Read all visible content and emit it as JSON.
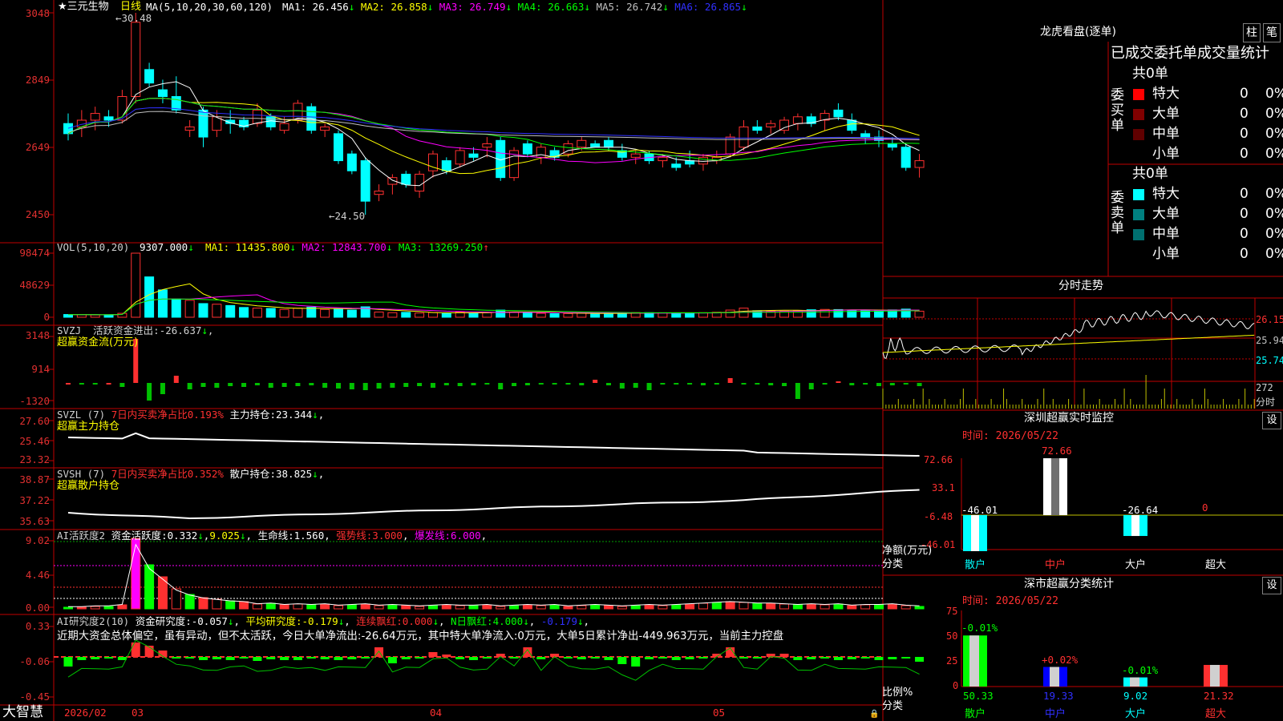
{
  "window": {
    "stock_label": "★三元生物",
    "period_label": "日线",
    "software": "大智慧"
  },
  "colors": {
    "up": "#ff3030",
    "down": "#00ffff",
    "ma1": "#ffffff",
    "ma2": "#ffff00",
    "ma3": "#ff00ff",
    "ma4": "#00ff00",
    "ma5": "#c0c0c0",
    "ma6": "#3030ff"
  },
  "price_panel": {
    "ma_title": "MA(5,10,20,30,60,120)",
    "ma_items": [
      {
        "label": "MA1:",
        "value": "26.456",
        "arrow": "↓",
        "color": "#ffffff"
      },
      {
        "label": "MA2:",
        "value": "26.858",
        "arrow": "↓",
        "color": "#ffff00"
      },
      {
        "label": "MA3:",
        "value": "26.749",
        "arrow": "↓",
        "color": "#ff00ff"
      },
      {
        "label": "MA4:",
        "value": "26.663",
        "arrow": "↓",
        "color": "#00ff00"
      },
      {
        "label": "MA5:",
        "value": "26.742",
        "arrow": "↓",
        "color": "#c0c0c0"
      },
      {
        "label": "MA6:",
        "value": "26.865",
        "arrow": "↓",
        "color": "#3030ff"
      }
    ],
    "y_ticks": [
      "3048",
      "2849",
      "2649",
      "2450"
    ],
    "high_mark": "30.48",
    "low_mark": "24.50"
  },
  "chart_data": {
    "type": "candlestick",
    "x_labels": [
      "2026/02",
      "03",
      "04",
      "05"
    ],
    "ylim": [
      24.0,
      31.0
    ],
    "candles": [
      [
        27.2,
        27.5,
        26.7,
        26.9
      ],
      [
        27.1,
        27.6,
        26.8,
        27.3
      ],
      [
        27.3,
        27.7,
        27.0,
        27.5
      ],
      [
        27.4,
        27.6,
        27.1,
        27.3
      ],
      [
        27.3,
        28.2,
        27.2,
        28.0
      ],
      [
        28.0,
        30.48,
        27.8,
        30.2
      ],
      [
        28.8,
        29.0,
        28.3,
        28.4
      ],
      [
        28.2,
        28.5,
        27.8,
        28.0
      ],
      [
        28.0,
        28.6,
        27.5,
        27.6
      ],
      [
        27.0,
        27.3,
        26.8,
        27.1
      ],
      [
        27.6,
        27.7,
        26.5,
        26.8
      ],
      [
        27.0,
        27.6,
        26.8,
        27.4
      ],
      [
        27.3,
        27.6,
        26.9,
        27.2
      ],
      [
        27.3,
        27.4,
        27.0,
        27.1
      ],
      [
        27.2,
        27.8,
        27.1,
        27.6
      ],
      [
        27.4,
        27.5,
        27.0,
        27.1
      ],
      [
        27.0,
        27.4,
        26.9,
        27.2
      ],
      [
        27.3,
        27.9,
        27.2,
        27.8
      ],
      [
        27.7,
        27.8,
        26.9,
        27.0
      ],
      [
        27.0,
        27.2,
        26.8,
        27.1
      ],
      [
        26.9,
        27.0,
        26.0,
        26.1
      ],
      [
        26.3,
        26.4,
        25.7,
        25.8
      ],
      [
        26.1,
        26.2,
        24.5,
        24.9
      ],
      [
        25.1,
        25.4,
        24.9,
        25.2
      ],
      [
        25.4,
        25.7,
        25.1,
        25.6
      ],
      [
        25.7,
        25.8,
        25.3,
        25.4
      ],
      [
        25.2,
        25.8,
        25.0,
        25.7
      ],
      [
        25.8,
        26.4,
        25.6,
        26.3
      ],
      [
        26.1,
        26.2,
        25.7,
        25.8
      ],
      [
        26.0,
        26.5,
        25.9,
        26.4
      ],
      [
        26.3,
        26.5,
        26.1,
        26.2
      ],
      [
        26.5,
        26.8,
        26.2,
        26.6
      ],
      [
        26.7,
        26.8,
        25.5,
        25.6
      ],
      [
        25.6,
        26.5,
        25.5,
        26.4
      ],
      [
        26.6,
        26.7,
        26.2,
        26.3
      ],
      [
        26.2,
        26.6,
        26.0,
        26.5
      ],
      [
        26.4,
        26.5,
        26.1,
        26.2
      ],
      [
        26.3,
        26.7,
        26.2,
        26.6
      ],
      [
        26.5,
        26.8,
        26.4,
        26.7
      ],
      [
        26.6,
        26.7,
        26.5,
        26.5
      ],
      [
        26.7,
        26.8,
        26.4,
        26.5
      ],
      [
        26.4,
        26.6,
        26.1,
        26.2
      ],
      [
        26.2,
        26.4,
        26.0,
        26.3
      ],
      [
        26.3,
        26.4,
        26.0,
        26.1
      ],
      [
        26.1,
        26.3,
        25.9,
        26.2
      ],
      [
        26.0,
        26.2,
        25.8,
        25.9
      ],
      [
        26.1,
        26.4,
        25.9,
        26.0
      ],
      [
        26.0,
        26.3,
        25.8,
        26.2
      ],
      [
        26.1,
        26.4,
        26.0,
        26.2
      ],
      [
        26.3,
        26.9,
        26.2,
        26.8
      ],
      [
        26.5,
        27.3,
        26.4,
        27.1
      ],
      [
        27.1,
        27.3,
        26.9,
        27.0
      ],
      [
        27.1,
        27.3,
        26.9,
        27.2
      ],
      [
        27.0,
        27.4,
        26.9,
        27.3
      ],
      [
        27.2,
        27.5,
        27.0,
        27.4
      ],
      [
        27.4,
        27.5,
        27.1,
        27.2
      ],
      [
        27.3,
        27.6,
        27.0,
        27.5
      ],
      [
        27.6,
        27.8,
        27.3,
        27.4
      ],
      [
        27.3,
        27.5,
        26.9,
        27.0
      ],
      [
        26.9,
        27.0,
        26.6,
        26.8
      ],
      [
        26.8,
        27.0,
        26.5,
        26.7
      ],
      [
        26.6,
        26.8,
        26.4,
        26.5
      ],
      [
        26.5,
        26.6,
        25.8,
        25.9
      ],
      [
        25.9,
        26.3,
        25.6,
        26.1
      ]
    ],
    "volume": [
      4200,
      4000,
      3500,
      3800,
      6000,
      98474,
      62000,
      42000,
      28000,
      26000,
      21000,
      20000,
      18000,
      15000,
      14000,
      13500,
      12000,
      14000,
      15500,
      12000,
      13000,
      11000,
      16000,
      8000,
      7000,
      7500,
      6500,
      7200,
      5500,
      8000,
      6500,
      7000,
      11000,
      8000,
      7500,
      6000,
      5500,
      5800,
      6200,
      5300,
      6000,
      6800,
      7200,
      7000,
      6900,
      6500,
      6700,
      7000,
      7600,
      11000,
      14000,
      10000,
      9800,
      9500,
      10200,
      11500,
      12000,
      11800,
      11000,
      10500,
      9800,
      11200,
      12500,
      9307
    ]
  },
  "vol_panel": {
    "title": "VOL(5,10,20)",
    "value": "9307.000",
    "arrow": "↓",
    "ma": [
      {
        "label": "MA1:",
        "value": "11435.800",
        "arrow": "↓",
        "color": "#ffff00"
      },
      {
        "label": "MA2:",
        "value": "12843.700",
        "arrow": "↓",
        "color": "#ff00ff"
      },
      {
        "label": "MA3:",
        "value": "13269.250",
        "arrow": "↑",
        "color": "#00ff00"
      }
    ],
    "y_ticks": [
      "98474",
      "48629",
      "0"
    ]
  },
  "svzj_panel": {
    "title": "SVZJ",
    "line": "活跃资金进出:-26.637",
    "arrow": "↓",
    "sub": "超赢资金流(万元)",
    "y_ticks": [
      "3148",
      "914",
      "-1320"
    ]
  },
  "svzl_panel": {
    "title": "SVZL (7)",
    "ratio": "7日内买卖净占比0.193%",
    "hold": "主力持仓:23.344",
    "arrow": "↓",
    "sub": "超赢主力持仓",
    "y_ticks": [
      "27.60",
      "25.46",
      "23.32"
    ]
  },
  "svsh_panel": {
    "title": "SVSH (7)",
    "ratio": "7日内买卖净占比0.352%",
    "hold": "散户持仓:38.825",
    "arrow": "↓",
    "sub": "超赢散户持仓",
    "y_ticks": [
      "38.87",
      "37.22",
      "35.63"
    ]
  },
  "ai1_panel": {
    "title": "AI活跃度2",
    "v1": "资金活跃度:0.332",
    "a1": "↓",
    "v2": "9.025",
    "a2": "↓",
    "v3": "生命线:1.560",
    "v4": "强势线:3.000",
    "v5": "爆发线:6.000",
    "y_ticks": [
      "9.02",
      "4.46",
      "0.00"
    ]
  },
  "ai2_panel": {
    "title": "AI研究度2(10)",
    "v1": "资金研究度:-0.057",
    "a1": "↓",
    "v2": "平均研究度:-0.179",
    "a2": "↓",
    "v3": "连续飘红:0.000",
    "a3": "↓",
    "v4": "N日飘红:4.000",
    "a4": "↓",
    "v5": "-0.179",
    "a5": "↓",
    "summary": "近期大资金总体偏空，虽有异动，但不太活跃，今日大单净流出:-26.64万元，其中特大单净流入:0万元，大单5日累计净出-449.963万元，当前主力控盘",
    "y_ticks": [
      "0.33",
      "-0.06",
      "-0.45"
    ]
  },
  "right": {
    "lh_title": "龙虎看盘(逐单)",
    "tab1": "柱",
    "tab2": "笔",
    "order_header": "已成交委托单成交量统计",
    "buy": {
      "side_label": "委买单",
      "total": "共0单",
      "rows": [
        {
          "label": "特大",
          "count": "0",
          "pct": "0%",
          "color": "#ff0000"
        },
        {
          "label": "大单",
          "count": "0",
          "pct": "0%",
          "color": "#800000"
        },
        {
          "label": "中单",
          "count": "0",
          "pct": "0%",
          "color": "#600000"
        },
        {
          "label": "小单",
          "count": "0",
          "pct": "0%",
          "color": "#000000"
        }
      ]
    },
    "sell": {
      "side_label": "委卖单",
      "total": "共0单",
      "rows": [
        {
          "label": "特大",
          "count": "0",
          "pct": "0%",
          "color": "#00ffff"
        },
        {
          "label": "大单",
          "count": "0",
          "pct": "0%",
          "color": "#008080"
        },
        {
          "label": "中单",
          "count": "0",
          "pct": "0%",
          "color": "#007070"
        },
        {
          "label": "小单",
          "count": "0",
          "pct": "0%",
          "color": "#000000"
        }
      ]
    },
    "intraday": {
      "title": "分时走势",
      "y": [
        "26.15",
        "25.94",
        "25.74"
      ],
      "vol": "272",
      "vol_unit": "分时"
    },
    "monitor": {
      "title": "深圳超赢实时监控",
      "set": "设",
      "date": "时间: 2026/05/22",
      "y": [
        "72.66",
        "33.1",
        "-6.48",
        "-46.01"
      ],
      "ylabel": "净额(万元)",
      "xlabel": "分类",
      "bars": [
        {
          "label": "散户",
          "value": -46.01,
          "text": "-46.01"
        },
        {
          "label": "中户",
          "value": 72.66,
          "text": "72.66"
        },
        {
          "label": "大户",
          "value": -26.64,
          "text": "-26.64"
        },
        {
          "label": "超大",
          "value": 0,
          "text": "0"
        }
      ]
    },
    "stats": {
      "title": "深市超赢分类统计",
      "set": "设",
      "date": "时间: 2026/05/22",
      "y": [
        "75",
        "50",
        "25",
        "0"
      ],
      "ylabel": "比例%",
      "xlabel": "分类",
      "bars": [
        {
          "label": "散户",
          "value": 50.33,
          "text": "50.33",
          "change": "-0.01%"
        },
        {
          "label": "中户",
          "value": 19.33,
          "text": "19.33",
          "change": "+0.02%"
        },
        {
          "label": "大户",
          "value": 9.02,
          "text": "9.02",
          "change": "-0.01%"
        },
        {
          "label": "超大",
          "value": 21.32,
          "text": "21.32",
          "change": ""
        }
      ]
    }
  }
}
